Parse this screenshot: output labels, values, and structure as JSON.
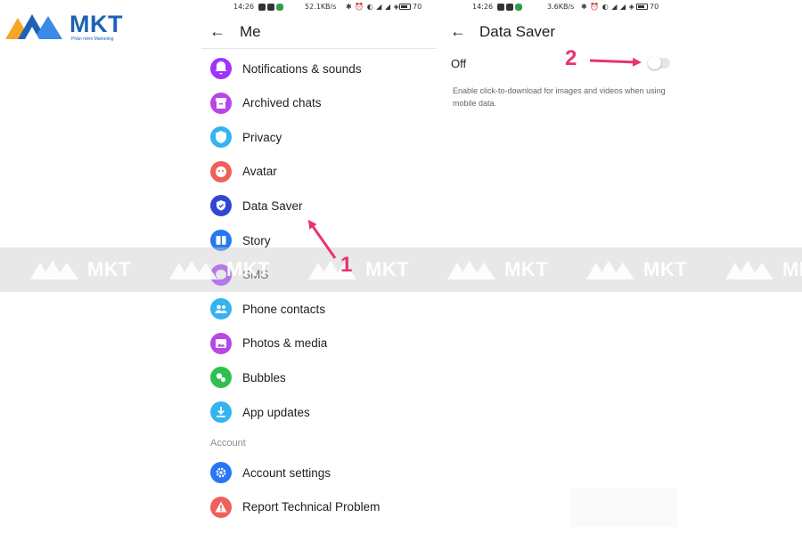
{
  "brand": {
    "logo_text": "MKT",
    "logo_subtitle": "Phần mềm Marketing",
    "watermark_text": "MKT",
    "colors": {
      "primary": "#1d62b5",
      "secondary": "#f5a623",
      "annotation": "#e8336f"
    }
  },
  "left_screen": {
    "status": {
      "time": "14:26",
      "speed": "52.1KB/s",
      "icons": "✱ ⏰ ◐ ◢ ◢ ◈",
      "battery": "70"
    },
    "header": {
      "back_icon": "←",
      "title": "Me"
    },
    "items": [
      {
        "label": "Notifications & sounds",
        "icon": "bell-icon",
        "color": "#a033ff"
      },
      {
        "label": "Archived chats",
        "icon": "archive-icon",
        "color": "#b646e8"
      },
      {
        "label": "Privacy",
        "icon": "shield-icon",
        "color": "#33b4f0"
      },
      {
        "label": "Avatar",
        "icon": "avatar-icon",
        "color": "#f0605a"
      },
      {
        "label": "Data Saver",
        "icon": "data-saver-icon",
        "color": "#3047d6"
      },
      {
        "label": "Story",
        "icon": "story-icon",
        "color": "#2877f2"
      },
      {
        "label": "SMS",
        "icon": "sms-icon",
        "color": "#a033ff"
      },
      {
        "label": "Phone contacts",
        "icon": "contacts-icon",
        "color": "#33b4f0"
      },
      {
        "label": "Photos & media",
        "icon": "photo-icon",
        "color": "#b646e8"
      },
      {
        "label": "Bubbles",
        "icon": "bubbles-icon",
        "color": "#2fc052"
      },
      {
        "label": "App updates",
        "icon": "download-icon",
        "color": "#33b4f0"
      }
    ],
    "section_account": "Account",
    "account_items": [
      {
        "label": "Account settings",
        "icon": "gear-icon",
        "color": "#2877f2"
      },
      {
        "label": "Report Technical Problem",
        "icon": "warning-icon",
        "color": "#f0605a"
      }
    ]
  },
  "right_screen": {
    "status": {
      "time": "14:26",
      "speed": "3.6KB/s",
      "icons": "✱ ⏰ ◐ ◢ ◢ ◈",
      "battery": "70"
    },
    "header": {
      "back_icon": "←",
      "title": "Data Saver"
    },
    "toggle_label": "Off",
    "toggle_state": "off",
    "description": "Enable click-to-download for images and videos when using mobile data."
  },
  "annotations": {
    "step1": "1",
    "step2": "2"
  }
}
